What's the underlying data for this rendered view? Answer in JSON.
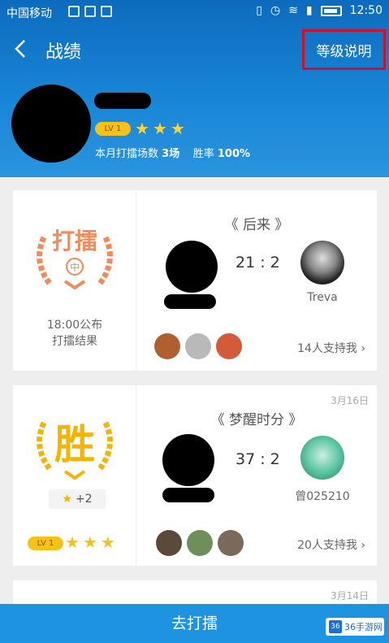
{
  "statusbar": {
    "carrier": "中国移动",
    "time": "12:50"
  },
  "nav": {
    "title": "战绩",
    "back_icon": "chevron-left-icon",
    "level_btn": "等级说明"
  },
  "profile": {
    "level": "LV 1",
    "stats_label": "本月打擂场数",
    "stats_count": "3场",
    "winrate_label": "胜率",
    "winrate": "100%"
  },
  "cards": [
    {
      "emblem_text": "打擂",
      "emblem_sub": "中",
      "result_line1": "18:00公布",
      "result_line2": "打擂结果",
      "song": "《 后来 》",
      "score": "21 : 2",
      "opponent": "Treva",
      "support": "14人支持我",
      "date": ""
    },
    {
      "emblem_text": "胜",
      "bonus": "+2",
      "level": "LV 1",
      "song": "《 梦醒时分 》",
      "score": "37 : 2",
      "opponent": "曾025210",
      "support": "20人支持我",
      "date": "3月16日"
    },
    {
      "date": "3月14日"
    }
  ],
  "bottom": {
    "button": "去打擂"
  },
  "watermark": {
    "icon": "36",
    "text": "36手游网"
  },
  "colors": {
    "accent": "#1e93e0",
    "header": "#1a87d8",
    "gold": "#f6c21a",
    "emblem_orange": "#f28b5a",
    "highlight": "#d0102a"
  }
}
